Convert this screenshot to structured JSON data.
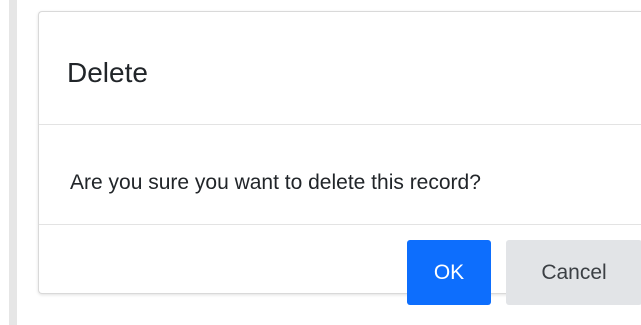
{
  "dialog": {
    "title": "Delete",
    "message": "Are you sure you want to delete this record?",
    "ok_label": "OK",
    "cancel_label": "Cancel"
  },
  "colors": {
    "primary_button": "#0d6efd",
    "secondary_button": "#e2e4e7",
    "text": "#212529"
  }
}
